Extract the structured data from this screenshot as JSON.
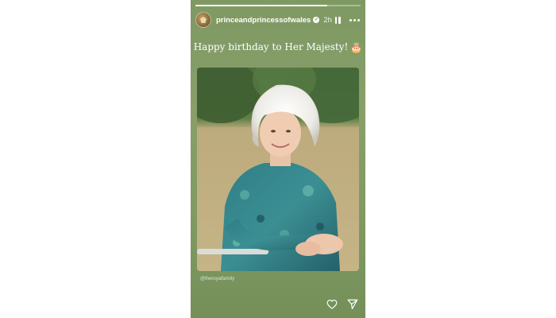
{
  "story": {
    "progress": 0.8,
    "account": {
      "username": "princeandprincessofwales",
      "verified": true,
      "time_ago": "2h"
    },
    "caption": {
      "text": "Happy birthday to Her Majesty!",
      "emoji": "🎂"
    },
    "photo_credit": "@theroyalfamily",
    "controls": {
      "pause_icon": "pause-icon",
      "more_icon": "more-options-icon",
      "like_icon": "heart-icon",
      "share_icon": "send-icon"
    }
  },
  "colors": {
    "story_background": "#829c66",
    "text": "#ffffff",
    "page_background": "#ffffff"
  }
}
